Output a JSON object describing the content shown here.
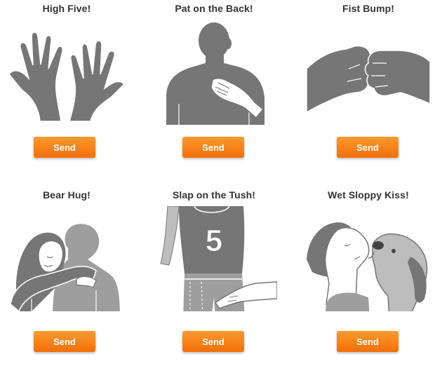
{
  "cards": [
    {
      "title": "High Five!",
      "image_icon": "high-five-hands-icon",
      "button_label": "Send"
    },
    {
      "title": "Pat on the Back!",
      "image_icon": "pat-on-back-icon",
      "button_label": "Send"
    },
    {
      "title": "Fist Bump!",
      "image_icon": "fist-bump-icon",
      "button_label": "Send"
    },
    {
      "title": "Bear Hug!",
      "image_icon": "bear-hug-icon",
      "button_label": "Send"
    },
    {
      "title": "Slap on the Tush!",
      "image_icon": "slap-on-tush-icon",
      "button_label": "Send"
    },
    {
      "title": "Wet Sloppy Kiss!",
      "image_icon": "dog-kiss-icon",
      "button_label": "Send"
    }
  ],
  "jersey_number": "5",
  "colors": {
    "button_top": "#fb9a2e",
    "button_bottom": "#f36f07",
    "illustration_dark": "#767676",
    "illustration_light": "#bdbdbd",
    "title_text": "#333333"
  }
}
